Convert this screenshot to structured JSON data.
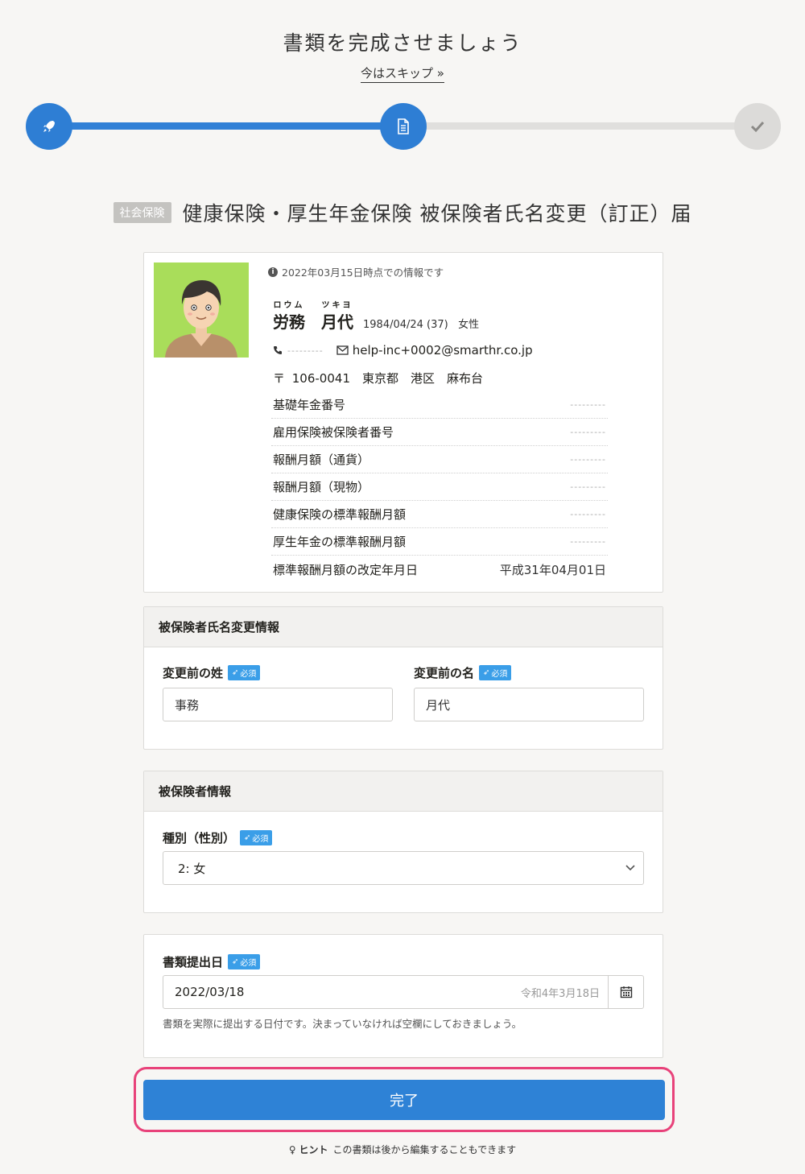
{
  "header": {
    "title": "書類を完成させましょう",
    "skip_label": "今はスキップ",
    "skip_icon": "»"
  },
  "stepper": {
    "steps": [
      {
        "icon": "rocket-icon",
        "state": "done"
      },
      {
        "icon": "document-icon",
        "state": "current"
      },
      {
        "icon": "check-icon",
        "state": "todo"
      }
    ],
    "colors": {
      "active": "#2e7ed4",
      "inactive": "#dcdbd9"
    }
  },
  "form": {
    "tag": "社会保険",
    "title": "健康保険・厚生年金保険 被保険者氏名変更（訂正）届"
  },
  "profile": {
    "info_note": "2022年03月15日時点での情報です",
    "last_name": "労務",
    "last_name_kana": "ロウム",
    "first_name": "月代",
    "first_name_kana": "ツキヨ",
    "birth_age": "1984/04/24 (37)",
    "gender": "女性",
    "phone": "---------",
    "email": "help-inc+0002@smarthr.co.jp",
    "address": "〒 106-0041　東京都　港区　麻布台",
    "fields": [
      {
        "label": "基礎年金番号",
        "value": "---------"
      },
      {
        "label": "雇用保険被保険者番号",
        "value": "---------"
      },
      {
        "label": "報酬月額（通貨）",
        "value": "---------"
      },
      {
        "label": "報酬月額（現物）",
        "value": "---------"
      },
      {
        "label": "健康保険の標準報酬月額",
        "value": "---------"
      },
      {
        "label": "厚生年金の標準報酬月額",
        "value": "---------"
      },
      {
        "label": "標準報酬月額の改定年月日",
        "value": "平成31年04月01日"
      }
    ]
  },
  "name_change": {
    "section_title": "被保険者氏名変更情報",
    "last_name_label": "変更前の姓",
    "last_name_value": "事務",
    "first_name_label": "変更前の名",
    "first_name_value": "月代",
    "required_label": "必須"
  },
  "insured": {
    "section_title": "被保険者情報",
    "type_label": "種別（性別）",
    "type_value": "2: 女",
    "required_label": "必須"
  },
  "submission": {
    "label": "書類提出日",
    "required_label": "必須",
    "date_value": "2022/03/18",
    "wareki": "令和4年3月18日",
    "help": "書類を実際に提出する日付です。決まっていなければ空欄にしておきましょう。"
  },
  "actions": {
    "complete_label": "完了",
    "highlight_color": "#e8427a"
  },
  "hint": {
    "label": "ヒント",
    "text": "この書類は後から編集することもできます"
  }
}
